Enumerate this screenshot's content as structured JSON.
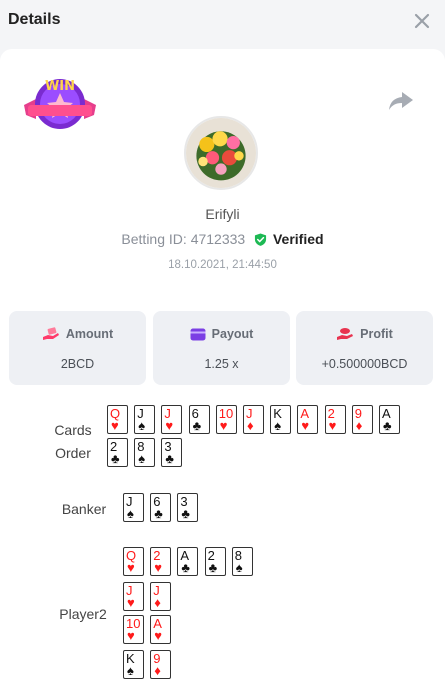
{
  "header": {
    "title": "Details"
  },
  "player": {
    "username": "Erifyli",
    "betting_id_label": "Betting ID:",
    "betting_id": "4712333",
    "verified": "Verified",
    "timestamp": "18.10.2021, 21:44:50"
  },
  "badge": {
    "text": "WIN"
  },
  "stats": [
    {
      "label": "Amount",
      "value": "2BCD",
      "icon": "money-hand-icon"
    },
    {
      "label": "Payout",
      "value": "1.25 x",
      "icon": "wallet-card-icon"
    },
    {
      "label": "Profit",
      "value": "+0.500000BCD",
      "icon": "coins-hand-icon"
    }
  ],
  "cards_order": {
    "label_line1": "Cards",
    "label_line2": "Order",
    "row1": [
      {
        "rank": "Q",
        "suit": "♥",
        "color": "red"
      },
      {
        "rank": "J",
        "suit": "♠",
        "color": "black"
      },
      {
        "rank": "J",
        "suit": "♥",
        "color": "red"
      },
      {
        "rank": "6",
        "suit": "♣",
        "color": "black"
      },
      {
        "rank": "10",
        "suit": "♥",
        "color": "red"
      },
      {
        "rank": "J",
        "suit": "♦",
        "color": "red"
      },
      {
        "rank": "K",
        "suit": "♠",
        "color": "black"
      },
      {
        "rank": "A",
        "suit": "♥",
        "color": "red"
      },
      {
        "rank": "2",
        "suit": "♥",
        "color": "red"
      },
      {
        "rank": "9",
        "suit": "♦",
        "color": "red"
      },
      {
        "rank": "A",
        "suit": "♣",
        "color": "black"
      }
    ],
    "row2": [
      {
        "rank": "2",
        "suit": "♣",
        "color": "black"
      },
      {
        "rank": "8",
        "suit": "♠",
        "color": "black"
      },
      {
        "rank": "3",
        "suit": "♣",
        "color": "black"
      }
    ]
  },
  "banker": {
    "label": "Banker",
    "cards": [
      {
        "rank": "J",
        "suit": "♠",
        "color": "black"
      },
      {
        "rank": "6",
        "suit": "♣",
        "color": "black"
      },
      {
        "rank": "3",
        "suit": "♣",
        "color": "black"
      }
    ]
  },
  "player2": {
    "label": "Player2",
    "rows": [
      [
        {
          "rank": "Q",
          "suit": "♥",
          "color": "red"
        },
        {
          "rank": "2",
          "suit": "♥",
          "color": "red"
        },
        {
          "rank": "A",
          "suit": "♣",
          "color": "black"
        },
        {
          "rank": "2",
          "suit": "♣",
          "color": "black"
        },
        {
          "rank": "8",
          "suit": "♠",
          "color": "black"
        }
      ],
      [
        {
          "rank": "J",
          "suit": "♥",
          "color": "red"
        },
        {
          "rank": "J",
          "suit": "♦",
          "color": "red"
        }
      ],
      [
        {
          "rank": "10",
          "suit": "♥",
          "color": "red"
        },
        {
          "rank": "A",
          "suit": "♥",
          "color": "red"
        }
      ],
      [
        {
          "rank": "K",
          "suit": "♠",
          "color": "black"
        },
        {
          "rank": "9",
          "suit": "♦",
          "color": "red"
        }
      ]
    ]
  },
  "colors": {
    "verified_green": "#1db954",
    "card_red": "#ff1a1a",
    "stat_icon_pink": "#ff3a6a",
    "stat_icon_purple": "#7b3fe4",
    "stat_icon_red": "#e8334f"
  }
}
